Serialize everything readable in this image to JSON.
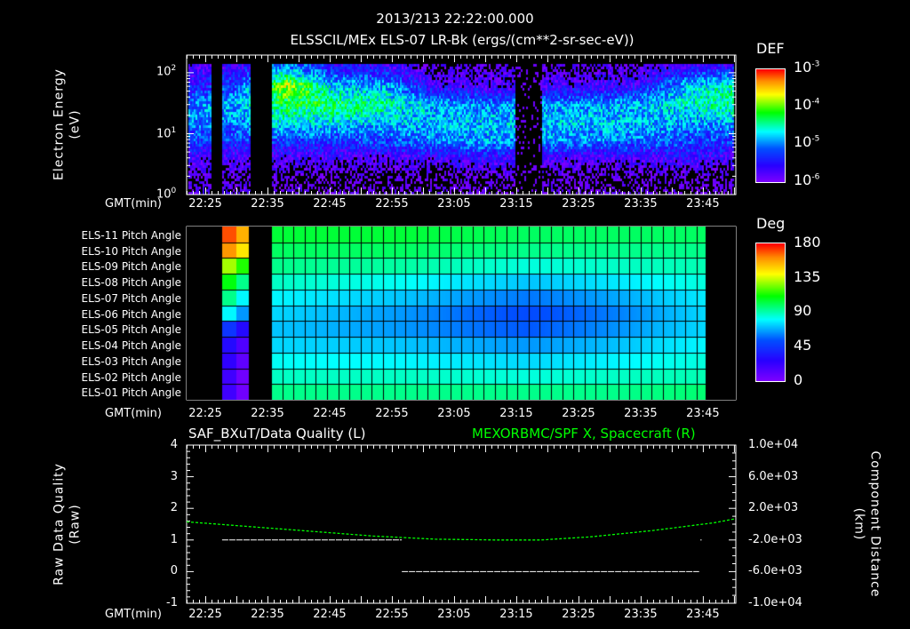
{
  "header": {
    "datetime": "2013/213 22:22:00.000",
    "title": "ELSSCIL/MEx ELS-07 LR-Bk  (ergs/(cm**2-sr-sec-eV))"
  },
  "time_axis": {
    "label": "GMT(min)",
    "ticks": [
      "22:25",
      "22:35",
      "22:45",
      "22:55",
      "23:05",
      "23:15",
      "23:25",
      "23:35",
      "23:45"
    ],
    "tick_minutes_after_start": [
      3,
      13,
      23,
      33,
      43,
      53,
      63,
      73,
      83
    ],
    "span_minutes": 88.3
  },
  "colors": {
    "background": "#000000",
    "axes": "#ffffff",
    "spacecraft_series": "#00ff00",
    "quality_series": "#ffffff"
  },
  "chart_data": [
    {
      "type": "heatmap",
      "title": "ELSSCIL/MEx ELS-07 LR-Bk  (ergs/(cm**2-sr-sec-eV))",
      "ylabel_line1": "Electron Energy",
      "ylabel_line2": "(eV)",
      "yscale": "log",
      "ylim": [
        1,
        195
      ],
      "yticks": [
        {
          "base": "10",
          "exp": "2"
        },
        {
          "base": "10",
          "exp": "1"
        },
        {
          "base": "10",
          "exp": "0"
        }
      ],
      "colorbar": {
        "label": "DEF",
        "scale": "log",
        "range": [
          -6,
          -3
        ],
        "ticks": [
          {
            "base": "10",
            "exp": "-3"
          },
          {
            "base": "10",
            "exp": "-4"
          },
          {
            "base": "10",
            "exp": "-5"
          },
          {
            "base": "10",
            "exp": "-6"
          }
        ]
      },
      "energies_eV": [
        2,
        4,
        8,
        16,
        32,
        64,
        128
      ],
      "times_min": [
        0,
        8,
        16,
        24,
        32,
        40,
        48,
        64,
        72,
        80,
        88
      ],
      "log10_def": [
        [
          -6.0,
          -5.7,
          -5.3,
          -5.0,
          -5.0,
          -5.5,
          -5.8
        ],
        [
          -6.0,
          -5.8,
          -5.3,
          -5.0,
          -4.8,
          -5.2,
          -5.6
        ],
        [
          -6.1,
          -5.8,
          -5.3,
          -4.6,
          -4.3,
          -3.8,
          -5.0
        ],
        [
          -6.1,
          -5.8,
          -5.3,
          -4.7,
          -4.3,
          -4.8,
          -5.5
        ],
        [
          -6.1,
          -5.8,
          -5.2,
          -4.8,
          -4.5,
          -4.9,
          -5.6
        ],
        [
          -6.1,
          -5.7,
          -5.0,
          -4.8,
          -4.9,
          -5.7,
          -6.0
        ],
        [
          -6.1,
          -5.6,
          -4.9,
          -4.8,
          -5.0,
          -5.8,
          -6.0
        ],
        [
          -6.1,
          -5.8,
          -5.0,
          -4.8,
          -4.9,
          -5.7,
          -6.0
        ],
        [
          -6.1,
          -5.8,
          -5.0,
          -4.8,
          -4.9,
          -5.6,
          -6.0
        ],
        [
          -6.1,
          -5.6,
          -5.2,
          -4.9,
          -4.6,
          -4.8,
          -5.6
        ],
        [
          -6.1,
          -5.8,
          -5.3,
          -4.9,
          -4.4,
          -4.5,
          -5.5
        ]
      ],
      "data_gaps_min": [
        [
          3.9,
          5.7
        ],
        [
          10.1,
          13.6
        ],
        [
          52.6,
          56.9
        ]
      ]
    },
    {
      "type": "heatmap",
      "rows": [
        "ELS-11 Pitch Angle",
        "ELS-10 Pitch Angle",
        "ELS-09 Pitch Angle",
        "ELS-08 Pitch Angle",
        "ELS-07 Pitch Angle",
        "ELS-06 Pitch Angle",
        "ELS-05 Pitch Angle",
        "ELS-04 Pitch Angle",
        "ELS-03 Pitch Angle",
        "ELS-02 Pitch Angle",
        "ELS-01 Pitch Angle"
      ],
      "colorbar": {
        "label": "Deg",
        "range": [
          0,
          180
        ],
        "ticks": [
          "180",
          "135",
          "90",
          "45",
          "0"
        ]
      },
      "early_block_min": [
        5.7,
        10.0
      ],
      "early_block_deg": [
        170,
        160,
        130,
        110,
        95,
        80,
        45,
        30,
        25,
        20,
        20
      ],
      "main_block_min": [
        13.6,
        83.3
      ],
      "main_times_min": [
        14,
        35,
        55,
        70,
        83
      ],
      "main_deg": [
        [
          105,
          105,
          100,
          100,
          100
        ],
        [
          100,
          100,
          95,
          95,
          95
        ],
        [
          95,
          92,
          85,
          88,
          90
        ],
        [
          88,
          82,
          72,
          78,
          85
        ],
        [
          80,
          72,
          60,
          68,
          78
        ],
        [
          75,
          65,
          52,
          62,
          75
        ],
        [
          72,
          65,
          55,
          65,
          75
        ],
        [
          75,
          72,
          65,
          72,
          80
        ],
        [
          82,
          80,
          75,
          80,
          85
        ],
        [
          88,
          88,
          85,
          88,
          90
        ],
        [
          95,
          95,
          95,
          95,
          98
        ]
      ]
    },
    {
      "type": "line",
      "left_title": "SAF_BXuT/Data Quality (L)",
      "right_title": "MEXORBMC/SPF X, Spacecraft (R)",
      "ylabel_left_line1": "Raw Data Quality",
      "ylabel_left_line2": "(Raw)",
      "ylabel_right_line1": "Component Distance",
      "ylabel_right_line2": "(km)",
      "ylim_left": [
        -1,
        4
      ],
      "yticks_left": [
        "4",
        "3",
        "2",
        "1",
        "0",
        "-1"
      ],
      "ylim_right": [
        -10000,
        10000
      ],
      "yticks_right": [
        "1.0e+04",
        "6.0e+03",
        "2.0e+03",
        "-2.0e+03",
        "-6.0e+03",
        "-1.0e+04"
      ],
      "series": [
        {
          "name": "Data Quality",
          "axis": "left",
          "segments": [
            {
              "from_min": 5.7,
              "to_min": 34.6,
              "value": 1
            },
            {
              "from_min": 34.6,
              "to_min": 82.4,
              "value": 0
            },
            {
              "from_min": 82.6,
              "to_min": 82.8,
              "value": 1
            }
          ]
        },
        {
          "name": "Spacecraft X (km)",
          "axis": "right",
          "x": [
            0,
            10,
            20,
            30,
            40,
            50,
            57,
            65,
            75,
            85,
            88.3
          ],
          "y": [
            300,
            -300,
            -900,
            -1500,
            -1900,
            -2000,
            -2000,
            -1600,
            -800,
            200,
            700
          ]
        }
      ]
    }
  ]
}
